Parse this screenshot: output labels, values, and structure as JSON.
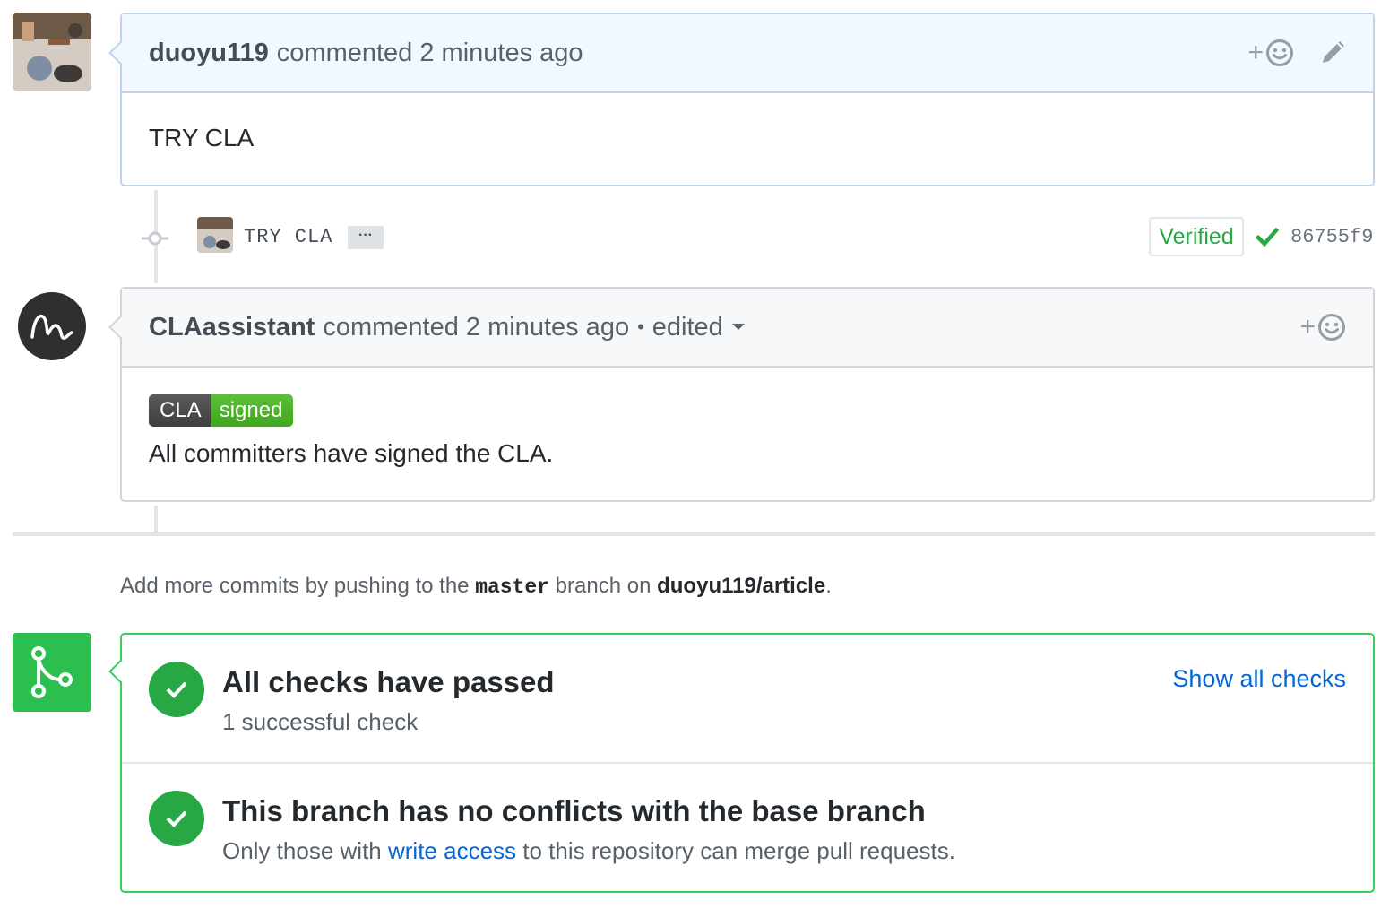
{
  "comment1": {
    "author": "duoyu119",
    "meta": "commented 2 minutes ago",
    "body": "TRY CLA",
    "icons": [
      "add-reaction-icon",
      "pencil-icon"
    ]
  },
  "commit": {
    "message": "TRY CLA",
    "ellipsis": "···",
    "verified": "Verified",
    "sha": "86755f9",
    "status_color": "#28a745"
  },
  "comment2": {
    "author": "CLAassistant",
    "meta": "commented 2 minutes ago",
    "separator": "•",
    "edited": "edited",
    "badge_left": "CLA",
    "badge_right": "signed",
    "body": "All committers have signed the CLA."
  },
  "hint": {
    "prefix": "Add more commits by pushing to the ",
    "branch": "master",
    "middle": " branch on ",
    "repo": "duoyu119/article",
    "suffix": "."
  },
  "merge": {
    "checks_title": "All checks have passed",
    "checks_sub": "1 successful check",
    "show_all": "Show all checks",
    "conflicts_title": "This branch has no conflicts with the base branch",
    "conflicts_sub_prefix": "Only those with ",
    "conflicts_sub_link": "write access",
    "conflicts_sub_suffix": " to this repository can merge pull requests.",
    "accent": "#2cbe4e"
  }
}
